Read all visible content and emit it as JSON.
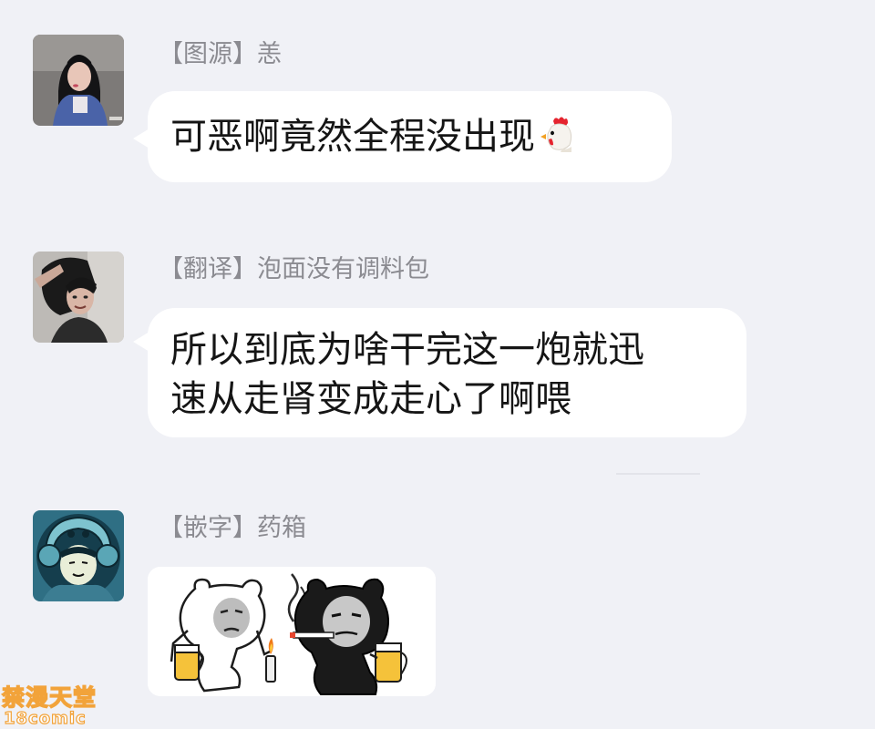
{
  "messages": [
    {
      "sender": "【图源】恙",
      "text": "可恶啊竟然全程没出现",
      "emoji": "🐔",
      "emoji_icon": "rooster-head-icon"
    },
    {
      "sender": "【翻译】泡面没有调料包",
      "text": "所以到底为啥干完这一炮就迅\n速从走肾变成走心了啊喂"
    },
    {
      "sender": "【嵌字】药箱",
      "sticker_icon": "panda-meme-smoking-beer-sticker"
    }
  ],
  "watermark": {
    "line1": "禁漫天堂",
    "line2": "18comic",
    "accent_color": "#f2a33a"
  },
  "colors": {
    "background": "#f0f1f6",
    "bubble": "#ffffff",
    "sender_text": "#8b8b91",
    "message_text": "#151515"
  }
}
